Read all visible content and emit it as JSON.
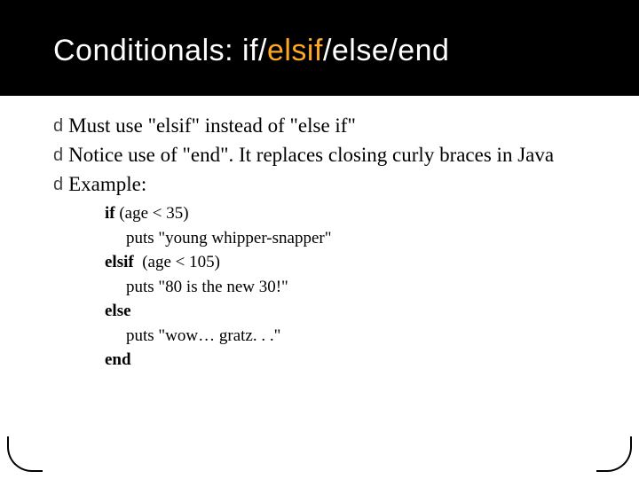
{
  "title": {
    "prefix": "Conditionals:  if/",
    "highlight": "elsif",
    "suffix": "/else/end"
  },
  "bullets": [
    "Must use \"elsif\" instead of \"else if\"",
    "Notice use of \"end\".  It replaces closing curly braces in Java",
    "Example:"
  ],
  "code": {
    "l1_kw": "if",
    "l1_rest": " (age < 35)",
    "l2": "puts \"young whipper-snapper\"",
    "l3_kw": "elsif",
    "l3_rest": "  (age < 105)",
    "l4": "puts \"80 is the new 30!\"",
    "l5_kw": "else",
    "l6": "puts \"wow… gratz. . .\"",
    "l7_kw": "end"
  },
  "glyph": "d"
}
